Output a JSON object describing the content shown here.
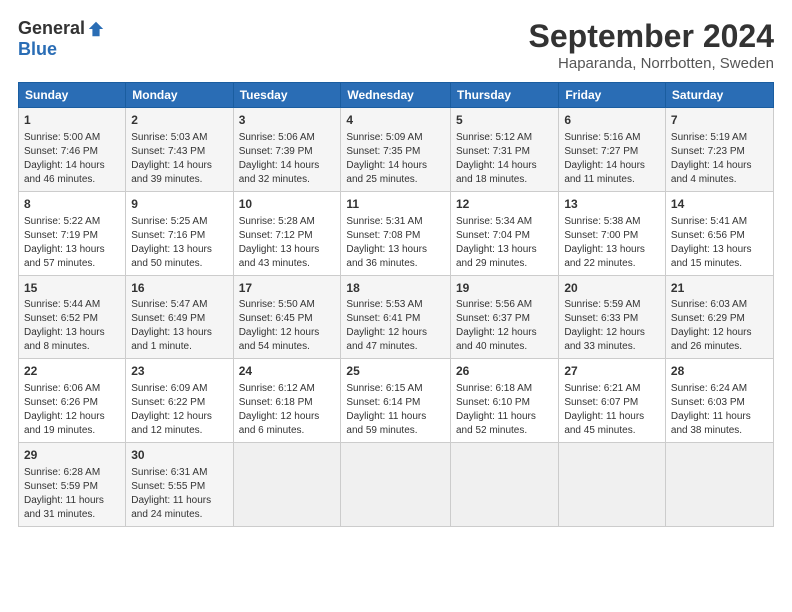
{
  "header": {
    "logo_general": "General",
    "logo_blue": "Blue",
    "month_title": "September 2024",
    "location": "Haparanda, Norrbotten, Sweden"
  },
  "columns": [
    "Sunday",
    "Monday",
    "Tuesday",
    "Wednesday",
    "Thursday",
    "Friday",
    "Saturday"
  ],
  "rows": [
    [
      {
        "day": "1",
        "info": "Sunrise: 5:00 AM\nSunset: 7:46 PM\nDaylight: 14 hours\nand 46 minutes."
      },
      {
        "day": "2",
        "info": "Sunrise: 5:03 AM\nSunset: 7:43 PM\nDaylight: 14 hours\nand 39 minutes."
      },
      {
        "day": "3",
        "info": "Sunrise: 5:06 AM\nSunset: 7:39 PM\nDaylight: 14 hours\nand 32 minutes."
      },
      {
        "day": "4",
        "info": "Sunrise: 5:09 AM\nSunset: 7:35 PM\nDaylight: 14 hours\nand 25 minutes."
      },
      {
        "day": "5",
        "info": "Sunrise: 5:12 AM\nSunset: 7:31 PM\nDaylight: 14 hours\nand 18 minutes."
      },
      {
        "day": "6",
        "info": "Sunrise: 5:16 AM\nSunset: 7:27 PM\nDaylight: 14 hours\nand 11 minutes."
      },
      {
        "day": "7",
        "info": "Sunrise: 5:19 AM\nSunset: 7:23 PM\nDaylight: 14 hours\nand 4 minutes."
      }
    ],
    [
      {
        "day": "8",
        "info": "Sunrise: 5:22 AM\nSunset: 7:19 PM\nDaylight: 13 hours\nand 57 minutes."
      },
      {
        "day": "9",
        "info": "Sunrise: 5:25 AM\nSunset: 7:16 PM\nDaylight: 13 hours\nand 50 minutes."
      },
      {
        "day": "10",
        "info": "Sunrise: 5:28 AM\nSunset: 7:12 PM\nDaylight: 13 hours\nand 43 minutes."
      },
      {
        "day": "11",
        "info": "Sunrise: 5:31 AM\nSunset: 7:08 PM\nDaylight: 13 hours\nand 36 minutes."
      },
      {
        "day": "12",
        "info": "Sunrise: 5:34 AM\nSunset: 7:04 PM\nDaylight: 13 hours\nand 29 minutes."
      },
      {
        "day": "13",
        "info": "Sunrise: 5:38 AM\nSunset: 7:00 PM\nDaylight: 13 hours\nand 22 minutes."
      },
      {
        "day": "14",
        "info": "Sunrise: 5:41 AM\nSunset: 6:56 PM\nDaylight: 13 hours\nand 15 minutes."
      }
    ],
    [
      {
        "day": "15",
        "info": "Sunrise: 5:44 AM\nSunset: 6:52 PM\nDaylight: 13 hours\nand 8 minutes."
      },
      {
        "day": "16",
        "info": "Sunrise: 5:47 AM\nSunset: 6:49 PM\nDaylight: 13 hours\nand 1 minute."
      },
      {
        "day": "17",
        "info": "Sunrise: 5:50 AM\nSunset: 6:45 PM\nDaylight: 12 hours\nand 54 minutes."
      },
      {
        "day": "18",
        "info": "Sunrise: 5:53 AM\nSunset: 6:41 PM\nDaylight: 12 hours\nand 47 minutes."
      },
      {
        "day": "19",
        "info": "Sunrise: 5:56 AM\nSunset: 6:37 PM\nDaylight: 12 hours\nand 40 minutes."
      },
      {
        "day": "20",
        "info": "Sunrise: 5:59 AM\nSunset: 6:33 PM\nDaylight: 12 hours\nand 33 minutes."
      },
      {
        "day": "21",
        "info": "Sunrise: 6:03 AM\nSunset: 6:29 PM\nDaylight: 12 hours\nand 26 minutes."
      }
    ],
    [
      {
        "day": "22",
        "info": "Sunrise: 6:06 AM\nSunset: 6:26 PM\nDaylight: 12 hours\nand 19 minutes."
      },
      {
        "day": "23",
        "info": "Sunrise: 6:09 AM\nSunset: 6:22 PM\nDaylight: 12 hours\nand 12 minutes."
      },
      {
        "day": "24",
        "info": "Sunrise: 6:12 AM\nSunset: 6:18 PM\nDaylight: 12 hours\nand 6 minutes."
      },
      {
        "day": "25",
        "info": "Sunrise: 6:15 AM\nSunset: 6:14 PM\nDaylight: 11 hours\nand 59 minutes."
      },
      {
        "day": "26",
        "info": "Sunrise: 6:18 AM\nSunset: 6:10 PM\nDaylight: 11 hours\nand 52 minutes."
      },
      {
        "day": "27",
        "info": "Sunrise: 6:21 AM\nSunset: 6:07 PM\nDaylight: 11 hours\nand 45 minutes."
      },
      {
        "day": "28",
        "info": "Sunrise: 6:24 AM\nSunset: 6:03 PM\nDaylight: 11 hours\nand 38 minutes."
      }
    ],
    [
      {
        "day": "29",
        "info": "Sunrise: 6:28 AM\nSunset: 5:59 PM\nDaylight: 11 hours\nand 31 minutes."
      },
      {
        "day": "30",
        "info": "Sunrise: 6:31 AM\nSunset: 5:55 PM\nDaylight: 11 hours\nand 24 minutes."
      },
      {
        "day": "",
        "info": ""
      },
      {
        "day": "",
        "info": ""
      },
      {
        "day": "",
        "info": ""
      },
      {
        "day": "",
        "info": ""
      },
      {
        "day": "",
        "info": ""
      }
    ]
  ]
}
